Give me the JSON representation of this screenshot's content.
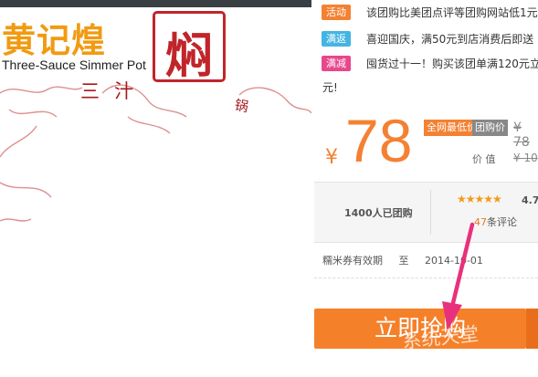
{
  "brand": {
    "name_zh": "黄记煌",
    "name_en": "Three-Sauce Simmer Pot",
    "seal_char": "焖",
    "subtitle_zh": "三汁",
    "pot_char": "锅"
  },
  "promos": [
    {
      "badge": "活动",
      "badge_color": "#f48132",
      "text": "该团购比美团点评等团购网站低1元"
    },
    {
      "badge": "满返",
      "badge_color": "#44b5e2",
      "text": "喜迎国庆，满50元到店消费后即送"
    },
    {
      "badge": "满减",
      "badge_color": "#e8478c",
      "text": "囤货过十一！购买该团单满120元立"
    }
  ],
  "promo_continuation": "元!",
  "price": {
    "currency": "¥",
    "value": "78",
    "tag_lowest": "全网最低价",
    "tag_lowest_color": "#f48132",
    "tag_group": "团购价",
    "tag_group_color": "#888888",
    "original": "¥ 78",
    "value_label": "价    值",
    "value_amount": "¥ 10"
  },
  "stats": {
    "sold": "1400人已团购",
    "stars": "★★★★★",
    "rating": "4.7",
    "reviews_num": "47",
    "reviews_suffix": "条评论"
  },
  "validity": {
    "label": "糯米券有效期",
    "to": "至",
    "date": "2014-10-01"
  },
  "buy_button": {
    "label": "立即抢购"
  },
  "watermark": "系统天堂",
  "colors": {
    "accent": "#f48132",
    "arrow": "#e8317c"
  }
}
